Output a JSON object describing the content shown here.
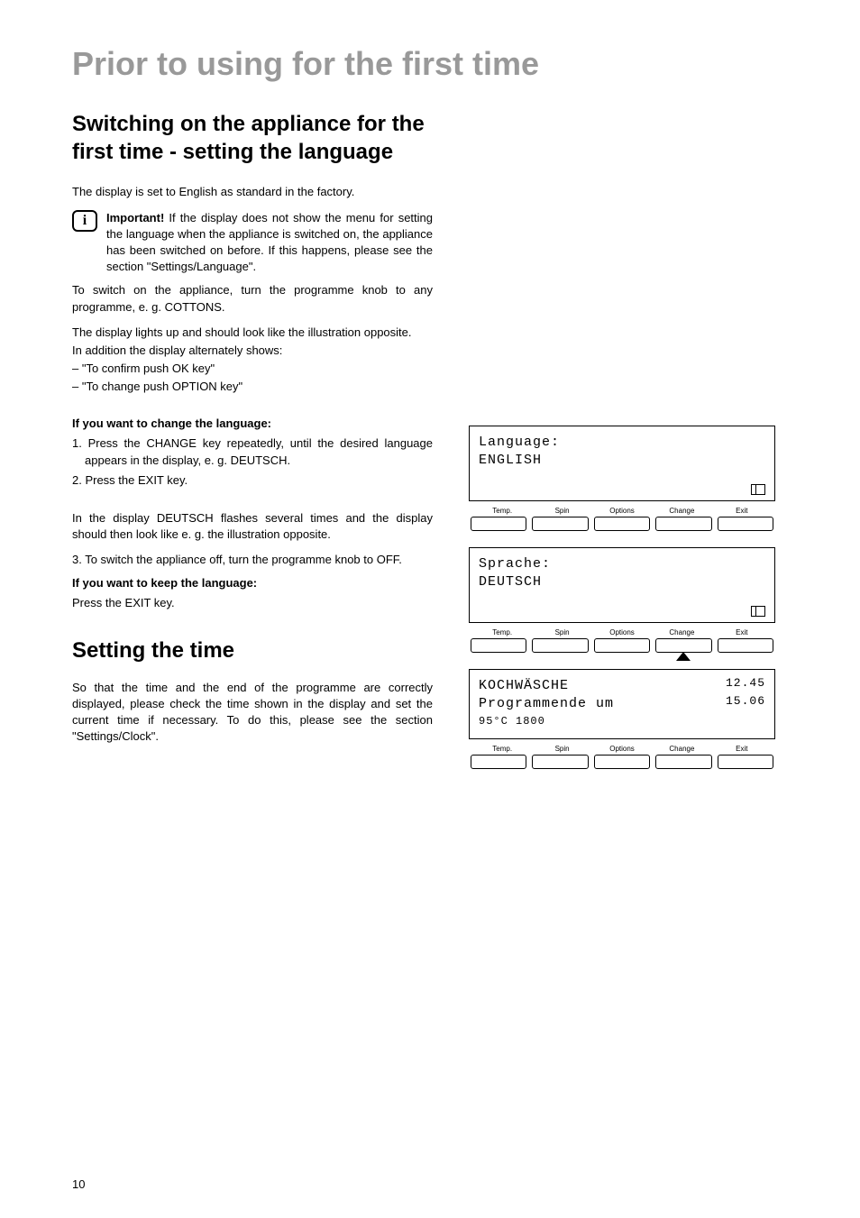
{
  "page_title": "Prior to using for the first time",
  "section1": {
    "heading": "Switching on the appliance for the first time - setting the language",
    "intro": "The display is set to English as standard in the factory.",
    "important_label": "Important!",
    "important_text": " If the display does not show the menu for setting the language when the appliance is switched on, the appliance has been switched on before. If this happens, please see the section \"Settings/Language\".",
    "para2": "To switch on the appliance, turn the programme knob to any programme, e. g. COTTONS.",
    "para3": "The display lights up and should look like the illustration opposite.",
    "para4": "In addition the display alternately shows:",
    "bullet1": "– \"To confirm push OK key\"",
    "bullet2": "– \"To change push OPTION key\"",
    "change_heading": "If you want to change the language:",
    "step1": "1. Press the CHANGE key repeatedly, until the desired language appears in the display, e. g. DEUTSCH.",
    "step2": "2. Press the EXIT key.",
    "para5": "In the display DEUTSCH flashes several times and the display should then look like e. g. the illustration opposite.",
    "step3": "3. To switch the appliance off, turn the programme knob to OFF.",
    "keep_heading": "If you want to keep the language:",
    "para6": "Press the EXIT key."
  },
  "section2": {
    "heading": "Setting the time",
    "para": "So that the time and the end of the programme are correctly displayed, please check the time shown in the display and set the current time if necessary. To do this, please see the section \"Settings/Clock\"."
  },
  "buttons": {
    "temp": "Temp.",
    "spin": "Spin",
    "options": "Options",
    "change": "Change",
    "exit": "Exit"
  },
  "displays": {
    "d1": {
      "line1": "Language:",
      "line2": "ENGLISH"
    },
    "d2": {
      "line1": "Sprache:",
      "line2": "DEUTSCH"
    },
    "d3": {
      "line1": "KOCHWÄSCHE",
      "line2": "Programmende um",
      "line3": "95°C 1800",
      "time1": "12.45",
      "time2": "15.06"
    }
  },
  "page_number": "10"
}
